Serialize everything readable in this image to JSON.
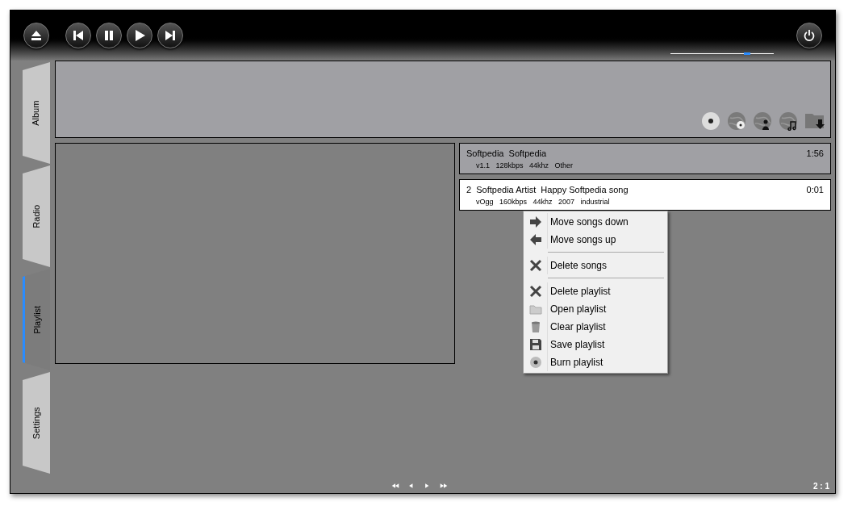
{
  "volume": {
    "level": 0.74
  },
  "tabs": [
    {
      "label": "Album",
      "selected": false
    },
    {
      "label": "Radio",
      "selected": false
    },
    {
      "label": "Playlist",
      "selected": true
    },
    {
      "label": "Settings",
      "selected": false
    }
  ],
  "tracks": [
    {
      "artist": "Softpedia",
      "title": "Softpedia",
      "duration": "1:56",
      "details": [
        "v1.1",
        "128kbps",
        "44khz",
        "Other"
      ],
      "selected": false
    },
    {
      "number": "2",
      "artist": "Softpedia Artist",
      "title": "Happy Softpedia song",
      "duration": "0:01",
      "details": [
        "vOgg",
        "160kbps",
        "44khz",
        "2007",
        "industrial"
      ],
      "selected": true
    }
  ],
  "context_menu": {
    "groups": [
      [
        {
          "label": "Move songs down",
          "kind": "down"
        },
        {
          "label": "Move songs up",
          "kind": "up"
        }
      ],
      [
        {
          "label": "Delete songs",
          "kind": "delete"
        }
      ],
      [
        {
          "label": "Delete playlist",
          "kind": "delete"
        },
        {
          "label": "Open playlist",
          "kind": "open"
        },
        {
          "label": "Clear playlist",
          "kind": "clear"
        },
        {
          "label": "Save playlist",
          "kind": "save"
        },
        {
          "label": "Burn playlist",
          "kind": "burn"
        }
      ]
    ]
  },
  "status": {
    "position": "2 : 1"
  }
}
